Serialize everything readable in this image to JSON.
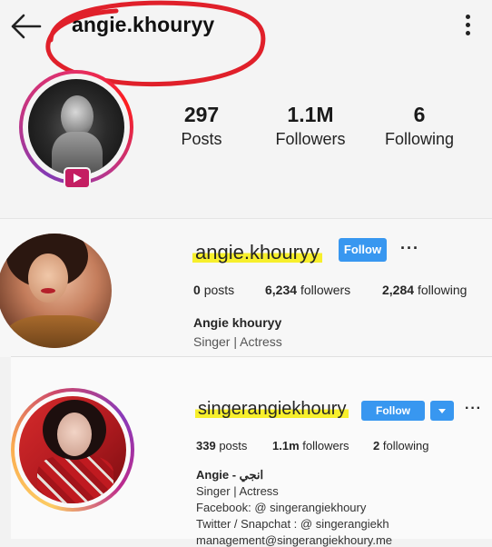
{
  "mobile_header": {
    "username": "angie.khouryy",
    "stats": [
      {
        "value": "297",
        "label": "Posts"
      },
      {
        "value": "1.1M",
        "label": "Followers"
      },
      {
        "value": "6",
        "label": "Following"
      }
    ],
    "annotation_color": "#e0202a"
  },
  "profile_1": {
    "username": "angie.khouryy",
    "follow_label": "Follow",
    "more_label": "···",
    "stats": [
      {
        "value": "0",
        "label": "posts"
      },
      {
        "value": "6,234",
        "label": "followers"
      },
      {
        "value": "2,284",
        "label": "following"
      }
    ],
    "name": "Angie khouryy",
    "bio": "Singer | Actress",
    "highlight_color": "#f7ef2c"
  },
  "profile_2": {
    "username": "singerangiekhoury",
    "follow_label": "Follow",
    "more_label": "···",
    "stats": [
      {
        "value": "339",
        "label": "posts"
      },
      {
        "value": "1.1m",
        "label": "followers"
      },
      {
        "value": "2",
        "label": "following"
      }
    ],
    "name": "Angie - انجي",
    "bio_lines": [
      "Singer | Actress",
      "Facebook: @ singerangiekhoury",
      "Twitter / Snapchat : @ singerangiekh",
      "management@singerangiekhoury.me"
    ],
    "button_color": "#3897f0"
  }
}
